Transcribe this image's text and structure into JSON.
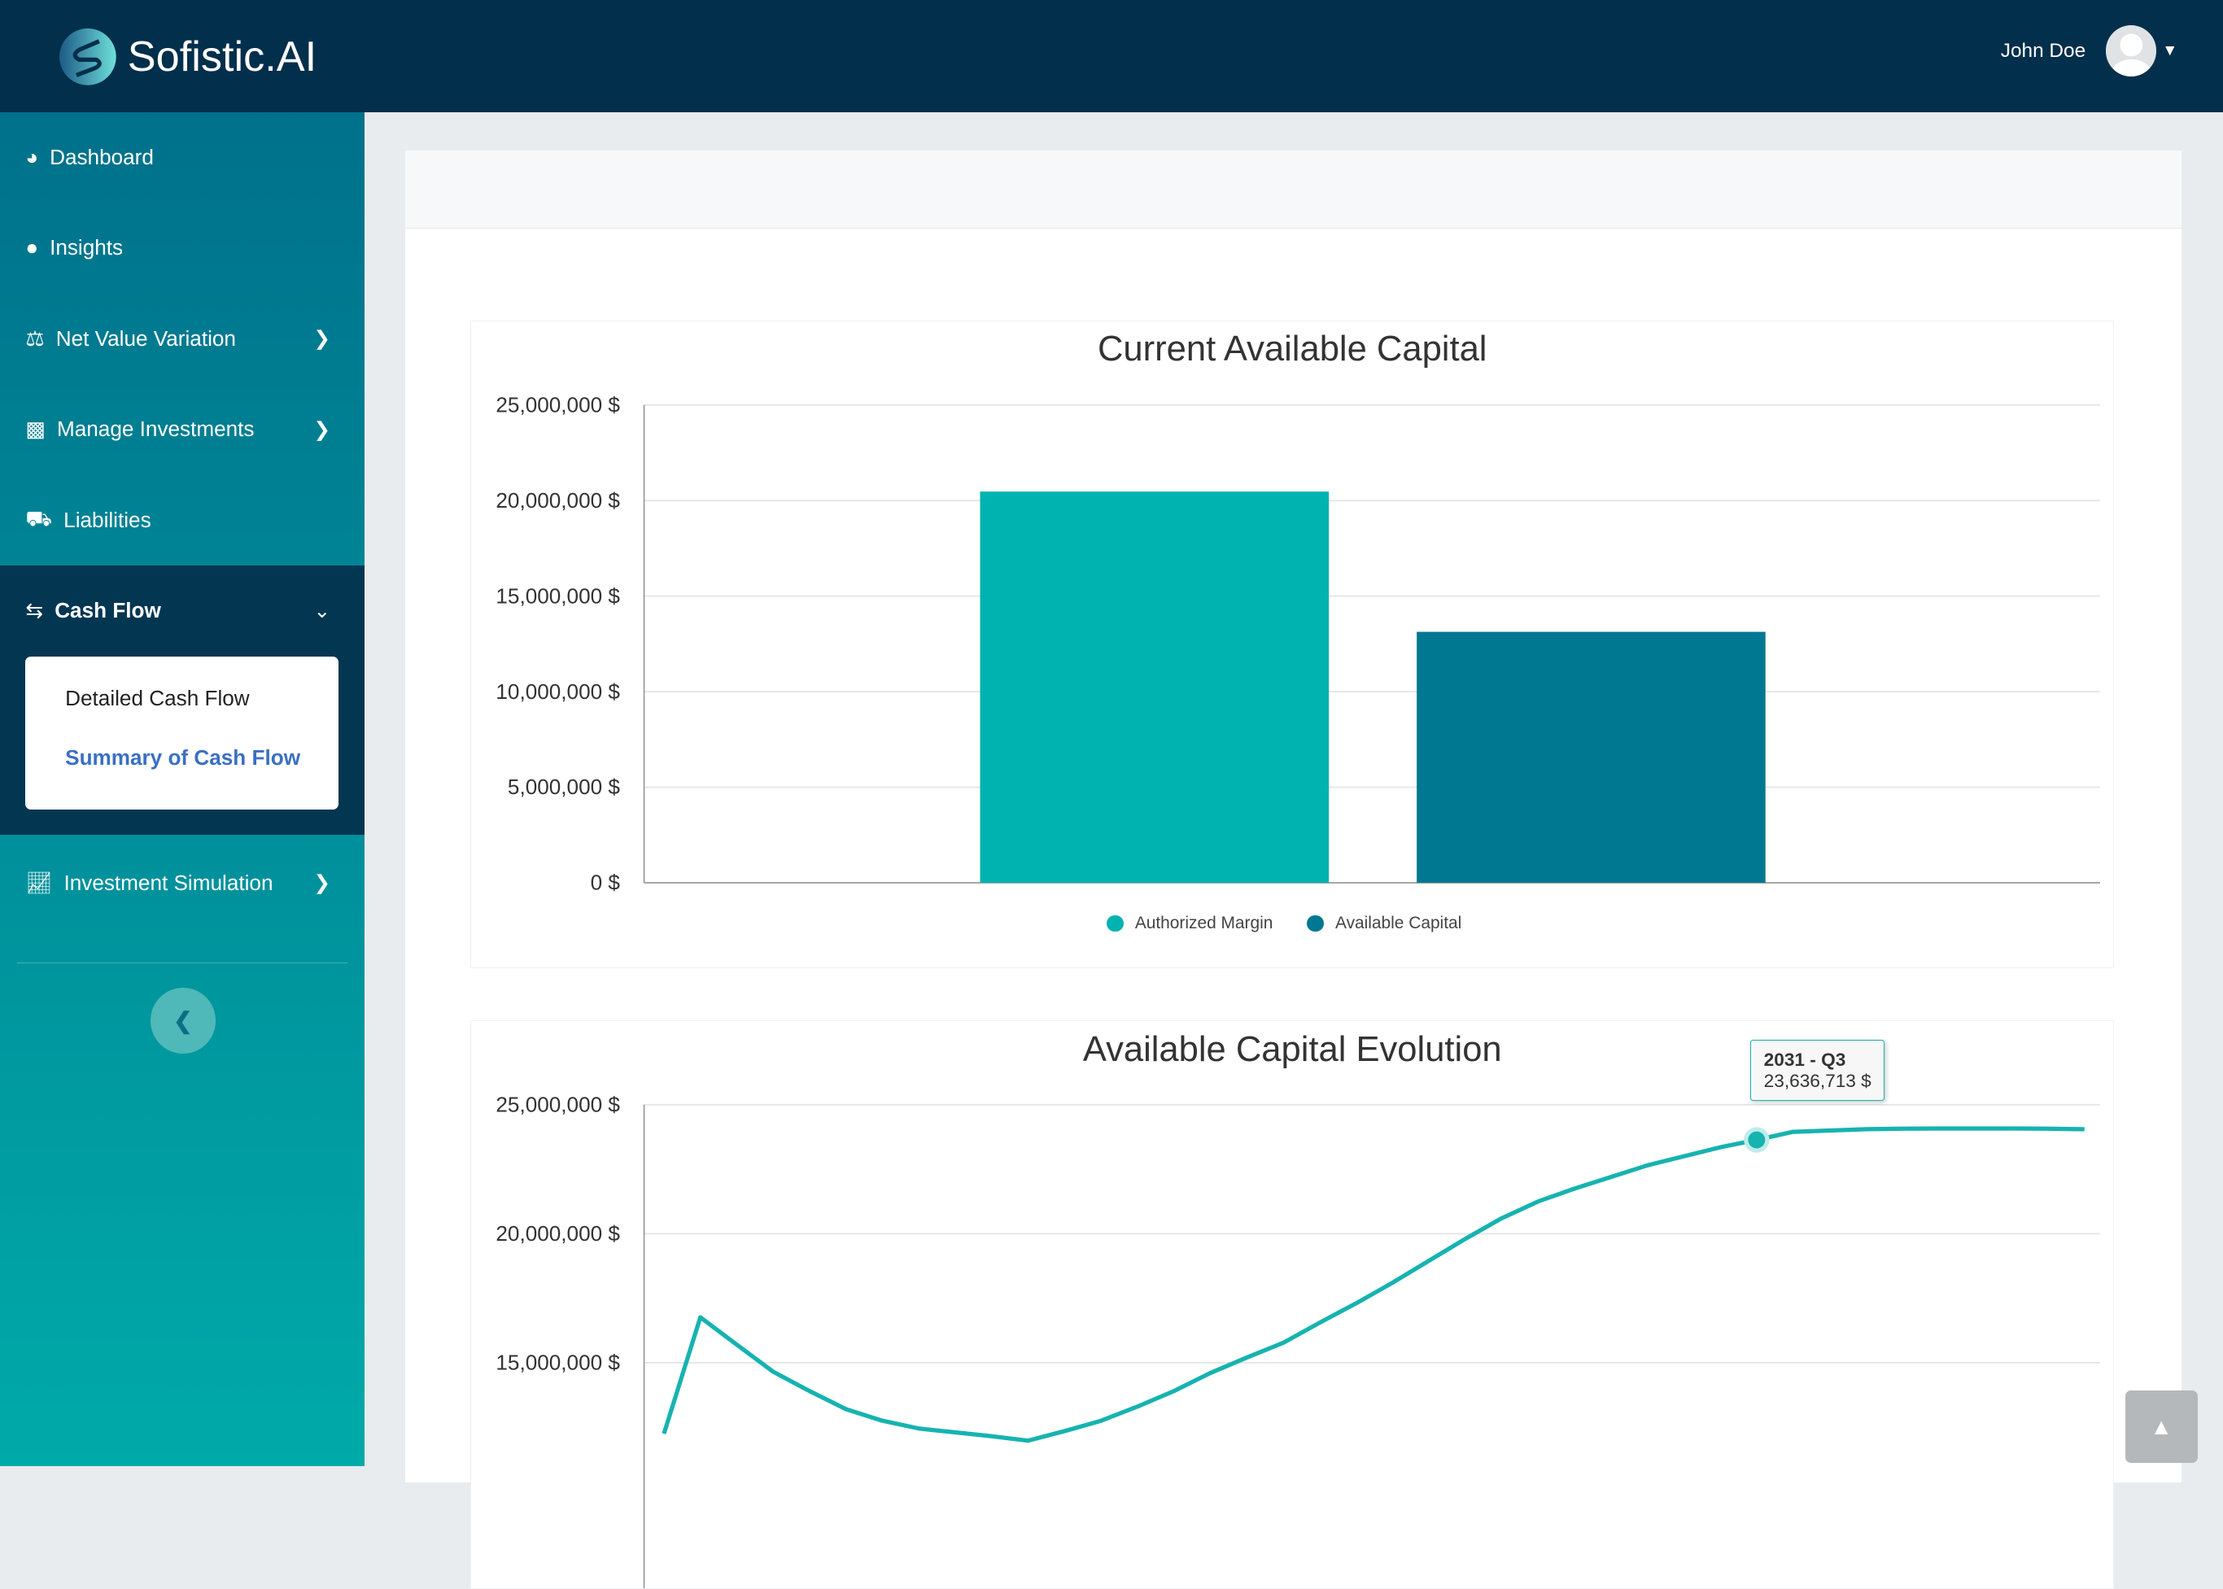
{
  "header": {
    "brand": "Sofistic.AI",
    "user_name": "John Doe"
  },
  "sidebar": {
    "items": [
      {
        "label": "Dashboard",
        "icon": "gauge-icon"
      },
      {
        "label": "Insights",
        "icon": "lightbulb-icon"
      },
      {
        "label": "Net Value Variation",
        "icon": "balance-scale-icon",
        "chevron": true
      },
      {
        "label": "Manage Investments",
        "icon": "boxes-icon",
        "chevron": true
      },
      {
        "label": "Liabilities",
        "icon": "car-icon"
      },
      {
        "label": "Cash Flow",
        "icon": "exchange-icon",
        "expanded": true
      },
      {
        "label": "Investment Simulation",
        "icon": "chart-line-icon",
        "chevron": true
      }
    ],
    "cash_flow_sub": [
      "Detailed Cash Flow",
      "Summary of Cash Flow"
    ],
    "selected_sub": "Summary of Cash Flow"
  },
  "colors": {
    "header": "#022f4b",
    "accent": "#00b3b0",
    "dark_teal": "#007891",
    "link": "#3a6fc4"
  },
  "chart_data": [
    {
      "type": "bar",
      "title": "Current Available Capital",
      "categories": [
        "Authorized Margin",
        "Available Capital"
      ],
      "values": [
        20470000,
        13130000
      ],
      "colors": [
        "#00b3b0",
        "#007891"
      ],
      "ylim": [
        0,
        25000000
      ],
      "yticks": [
        "0 $",
        "5,000,000 $",
        "10,000,000 $",
        "15,000,000 $",
        "20,000,000 $",
        "25,000,000 $"
      ],
      "legend": [
        "Authorized Margin",
        "Available Capital"
      ],
      "legend_position": "bottom",
      "grid": true
    },
    {
      "type": "line",
      "title": "Available Capital Evolution",
      "color": "#16b3b0",
      "values": [
        12250000,
        16760000,
        15700000,
        14650000,
        13900000,
        13200000,
        12750000,
        12450000,
        12300000,
        12150000,
        11980000,
        12350000,
        12750000,
        13300000,
        13900000,
        14600000,
        15200000,
        15770000,
        16550000,
        17300000,
        18100000,
        18950000,
        19800000,
        20600000,
        21250000,
        21750000,
        22200000,
        22650000,
        23000000,
        23350000,
        23636713,
        23950000,
        24000000,
        24050000,
        24070000,
        24080000,
        24080000,
        24080000,
        24070000,
        24050000
      ],
      "ylim": [
        10000000,
        25000000
      ],
      "yticks": [
        "15,000,000 $",
        "20,000,000 $",
        "25,000,000 $"
      ],
      "grid": true,
      "tooltip": {
        "index": 30,
        "label": "2031 - Q3",
        "value": "23,636,713 $"
      }
    }
  ]
}
